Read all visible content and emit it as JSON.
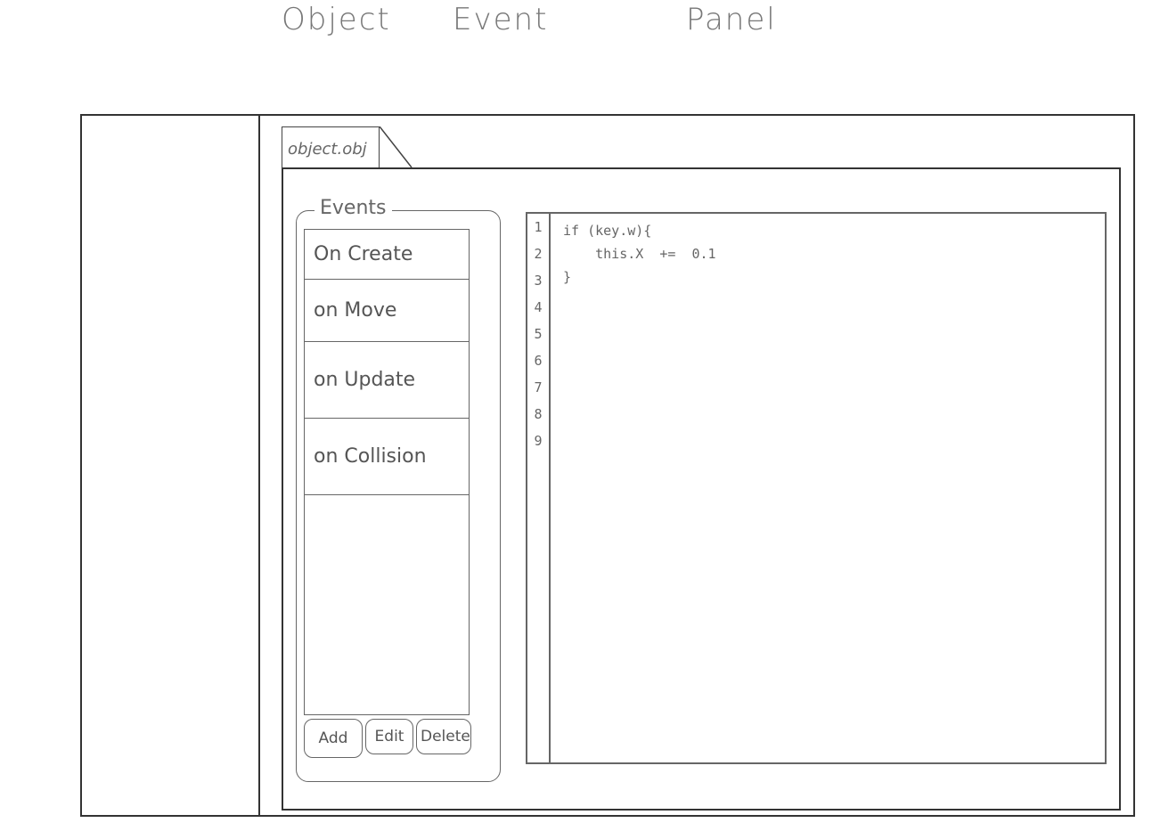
{
  "headings": [
    "Object",
    "Event",
    "Panel"
  ],
  "tab": {
    "label": "object.obj"
  },
  "events": {
    "legend": "Events",
    "items": [
      "On Create",
      "on Move",
      "on Update",
      "on Collision"
    ],
    "buttons": {
      "add": "Add",
      "edit": "Edit",
      "delete": "Delete"
    }
  },
  "editor": {
    "line_numbers": [
      "1",
      "2",
      "3",
      "4",
      "5",
      "6",
      "7",
      "8",
      "9"
    ],
    "code_lines": [
      "if (key.w){",
      "    this.X  +=  0.1",
      "}"
    ]
  }
}
